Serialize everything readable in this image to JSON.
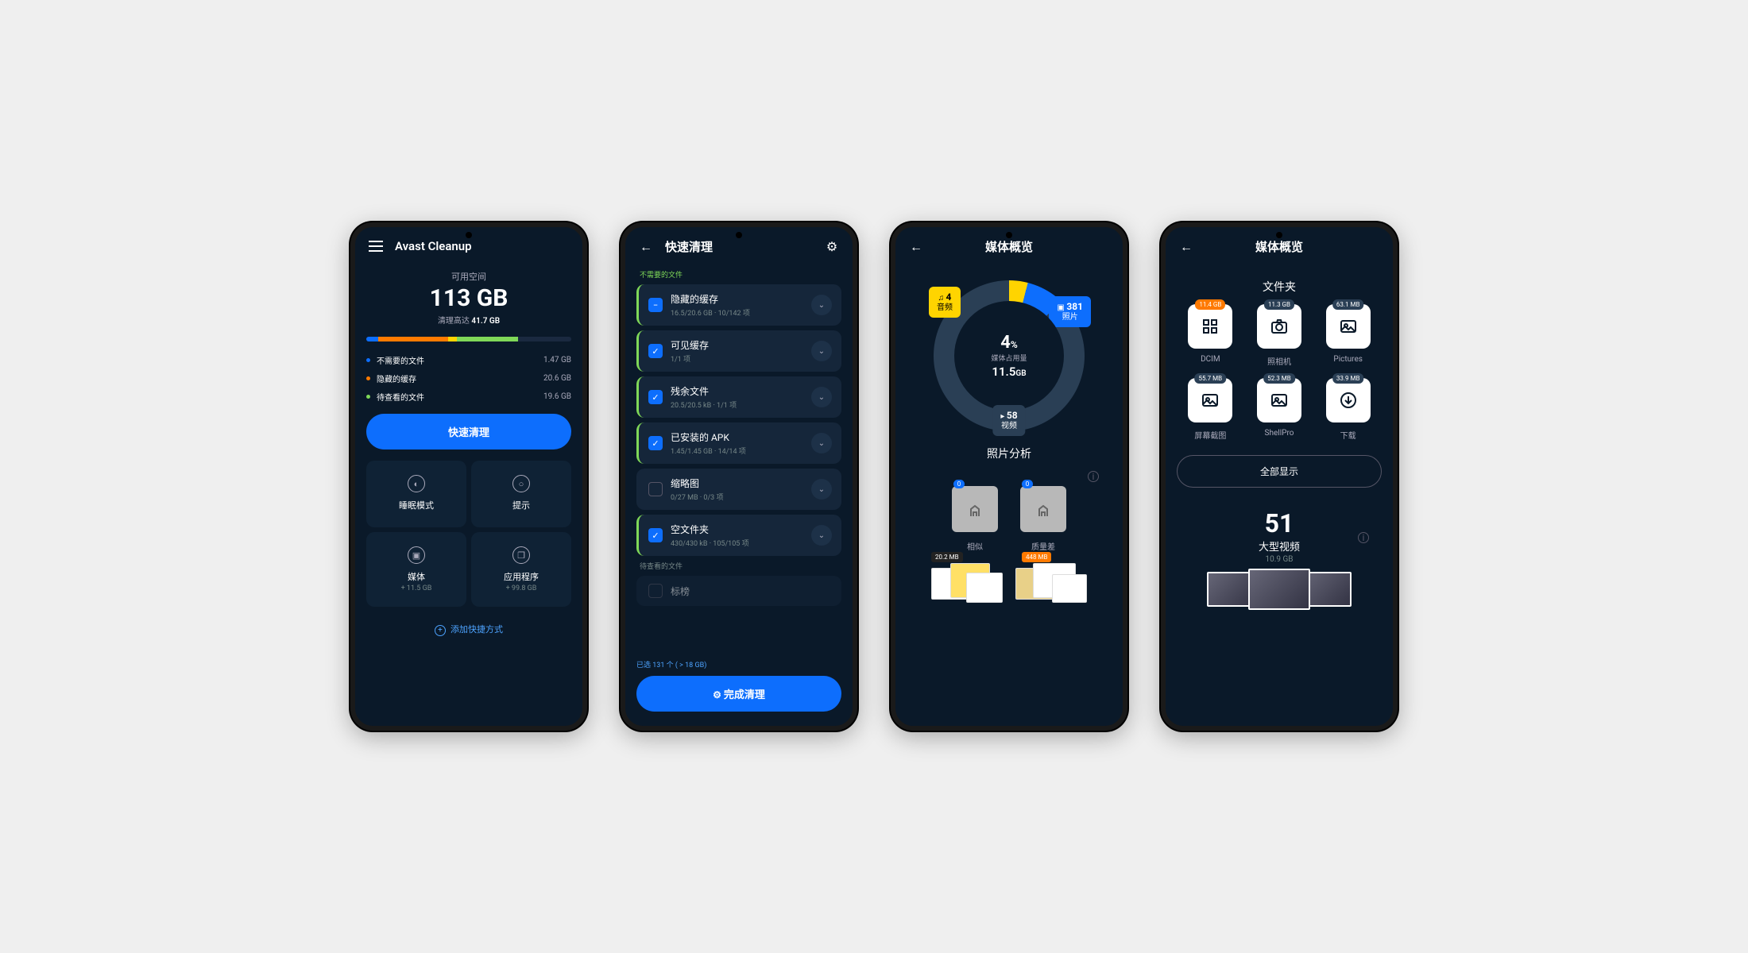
{
  "s1": {
    "title": "Avast Cleanup",
    "avail_label": "可用空间",
    "avail_value": "113 GB",
    "clean_upto_pre": "清理高达",
    "clean_upto_val": "41.7 GB",
    "bar": [
      {
        "color": "#0d6efd",
        "w": "6%"
      },
      {
        "color": "#ff7a00",
        "w": "34%"
      },
      {
        "color": "#ffd400",
        "w": "4%"
      },
      {
        "color": "#7fd858",
        "w": "30%"
      }
    ],
    "legend": [
      {
        "dot": "#0d6efd",
        "label": "不需要的文件",
        "value": "1.47 GB"
      },
      {
        "dot": "#ff7a00",
        "label": "隐藏的缓存",
        "value": "20.6 GB"
      },
      {
        "dot": "#7fd858",
        "label": "待查看的文件",
        "value": "19.6 GB"
      }
    ],
    "quick_clean": "快速清理",
    "tiles": [
      {
        "icon": "◐",
        "title": "睡眠模式",
        "sub": ""
      },
      {
        "icon": "○",
        "title": "提示",
        "sub": ""
      },
      {
        "icon": "▣",
        "title": "媒体",
        "sub": "+ 11.5 GB"
      },
      {
        "icon": "❐",
        "title": "应用程序",
        "sub": "+ 99.8 GB"
      }
    ],
    "add_shortcut": "添加快捷方式"
  },
  "s2": {
    "title": "快速清理",
    "section_unneeded": "不需要的文件",
    "section_review": "待查看的文件",
    "items": [
      {
        "chk": "minus",
        "title": "隐藏的缓存",
        "sub": "16.5/20.6 GB · 10/142 项"
      },
      {
        "chk": "check",
        "title": "可见缓存",
        "sub": "1/1 项"
      },
      {
        "chk": "check",
        "title": "残余文件",
        "sub": "20.5/20.5 kB · 1/1 项"
      },
      {
        "chk": "check",
        "title": "已安装的 APK",
        "sub": "1.45/1.45 GB · 14/14 项"
      },
      {
        "chk": "empty",
        "title": "缩略图",
        "sub": "0/27 MB · 0/3 项"
      },
      {
        "chk": "check",
        "title": "空文件夹",
        "sub": "430/430 kB · 105/105 项"
      }
    ],
    "review_item": {
      "title": "标榜"
    },
    "selected": "已选 131 个 ( > 18 GB)",
    "finish": "完成清理"
  },
  "s3": {
    "title": "媒体概览",
    "audio": {
      "count": "4",
      "label": "音频",
      "icon": "♫"
    },
    "photos": {
      "count": "381",
      "label": "照片",
      "icon": "▣"
    },
    "videos": {
      "count": "58",
      "label": "视频",
      "icon": "▸"
    },
    "percent": "4",
    "percent_suffix": "%",
    "usage_label": "媒体占用量",
    "usage_value": "11.5",
    "usage_unit": "GB",
    "analysis": "照片分析",
    "t1": {
      "badge": "0",
      "cap": "相似"
    },
    "t2": {
      "badge": "0",
      "cap": "质量差"
    },
    "g1_size": "20.2 MB",
    "g2_size": "448 MB"
  },
  "s4": {
    "title": "媒体概览",
    "folders_title": "文件夹",
    "folders": [
      {
        "size": "11.4 GB",
        "orange": true,
        "name": "DCIM",
        "icon": "grid"
      },
      {
        "size": "11.3 GB",
        "name": "照相机",
        "icon": "camera"
      },
      {
        "size": "63.1 MB",
        "name": "Pictures",
        "icon": "image"
      },
      {
        "size": "55.7 MB",
        "name": "屏幕截图",
        "icon": "image"
      },
      {
        "size": "52.3 MB",
        "name": "ShellPro",
        "icon": "image"
      },
      {
        "size": "33.9 MB",
        "name": "下载",
        "icon": "download"
      }
    ],
    "show_all": "全部显示",
    "bignum": "51",
    "biglabel": "大型视频",
    "bigsize": "10.9 GB"
  }
}
